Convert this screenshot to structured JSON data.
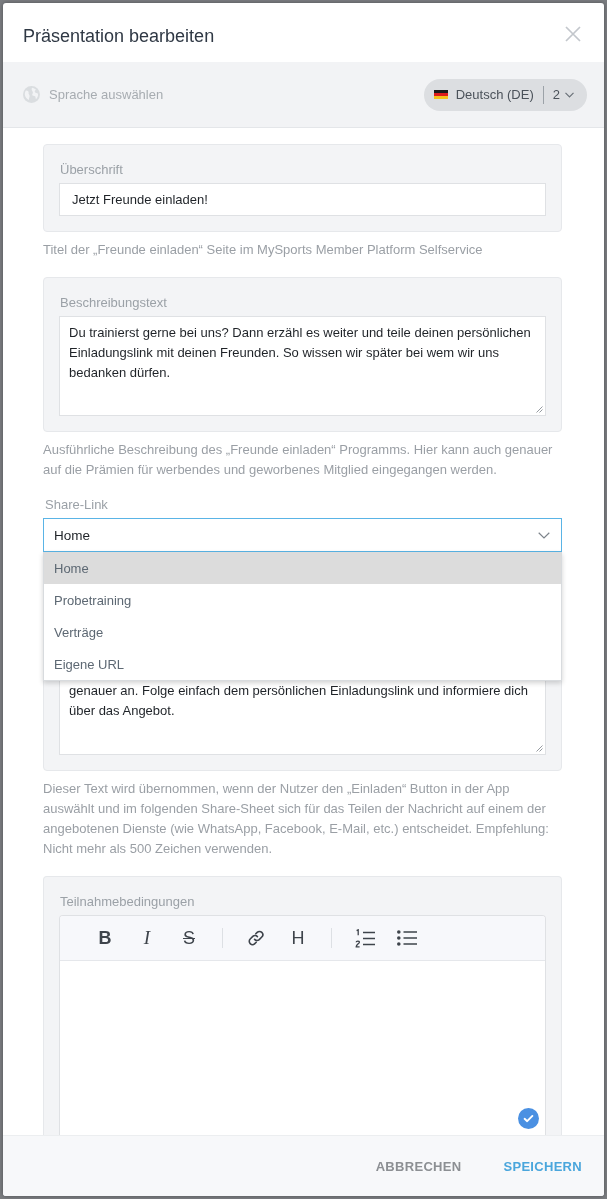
{
  "dialog": {
    "title": "Präsentation bearbeiten"
  },
  "language_bar": {
    "label": "Sprache auswählen",
    "language": "Deutsch (DE)",
    "count": "2"
  },
  "fields": [
    {
      "kind": "input",
      "label": "Überschrift",
      "value": "Jetzt Freunde einladen!",
      "help": "Titel der „Freunde einladen“ Seite im MySports Member Platform Selfservice"
    },
    {
      "kind": "textarea",
      "label": "Beschreibungstext",
      "value": "Du trainierst gerne bei uns? Dann erzähl es weiter und teile deinen persönlichen Einladungslink mit deinen Freunden. So wissen wir später bei wem wir uns bedanken dürfen.",
      "help": "Ausführliche Beschreibung des „Freunde einladen“ Programms. Hier kann auch genauer auf die Prämien für werbendes und geworbenes Mitglied eingegangen werden."
    },
    {
      "kind": "select",
      "label": "Share-Link",
      "value": "Home",
      "expanded": true,
      "options": [
        {
          "label": "Home",
          "selected": true
        },
        {
          "label": "Probetraining",
          "selected": false
        },
        {
          "label": "Verträge",
          "selected": false
        },
        {
          "label": "Eigene URL",
          "selected": false
        }
      ]
    },
    {
      "kind": "textarea",
      "value": "genauer an. Folge einfach dem persönlichen Einladungslink und informiere dich über das Angebot.",
      "help": "Dieser Text wird übernommen, wenn der Nutzer den „Einladen“ Button in der App auswählt und im folgenden Share-Sheet sich für das Teilen der Nachricht auf einem der angebotenen Dienste (wie WhatsApp, Facebook, E-Mail, etc.) entscheidet. Empfehlung: Nicht mehr als 500 Zeichen verwenden."
    },
    {
      "kind": "editor",
      "label": "Teilnahmebedingungen",
      "toolbar": [
        {
          "kind": "bold",
          "glyph": "B"
        },
        {
          "kind": "italic",
          "glyph": "I"
        },
        {
          "kind": "strike",
          "glyph": "S"
        },
        {
          "kind": "separator"
        },
        {
          "kind": "link"
        },
        {
          "kind": "heading",
          "glyph": "H"
        },
        {
          "kind": "separator"
        },
        {
          "kind": "ordered_list"
        },
        {
          "kind": "bullet_list"
        }
      ]
    }
  ],
  "footer": {
    "buttons": [
      {
        "label": "ABBRECHEN",
        "kind": "cancel"
      },
      {
        "label": "SPEICHERN",
        "kind": "save"
      }
    ]
  }
}
